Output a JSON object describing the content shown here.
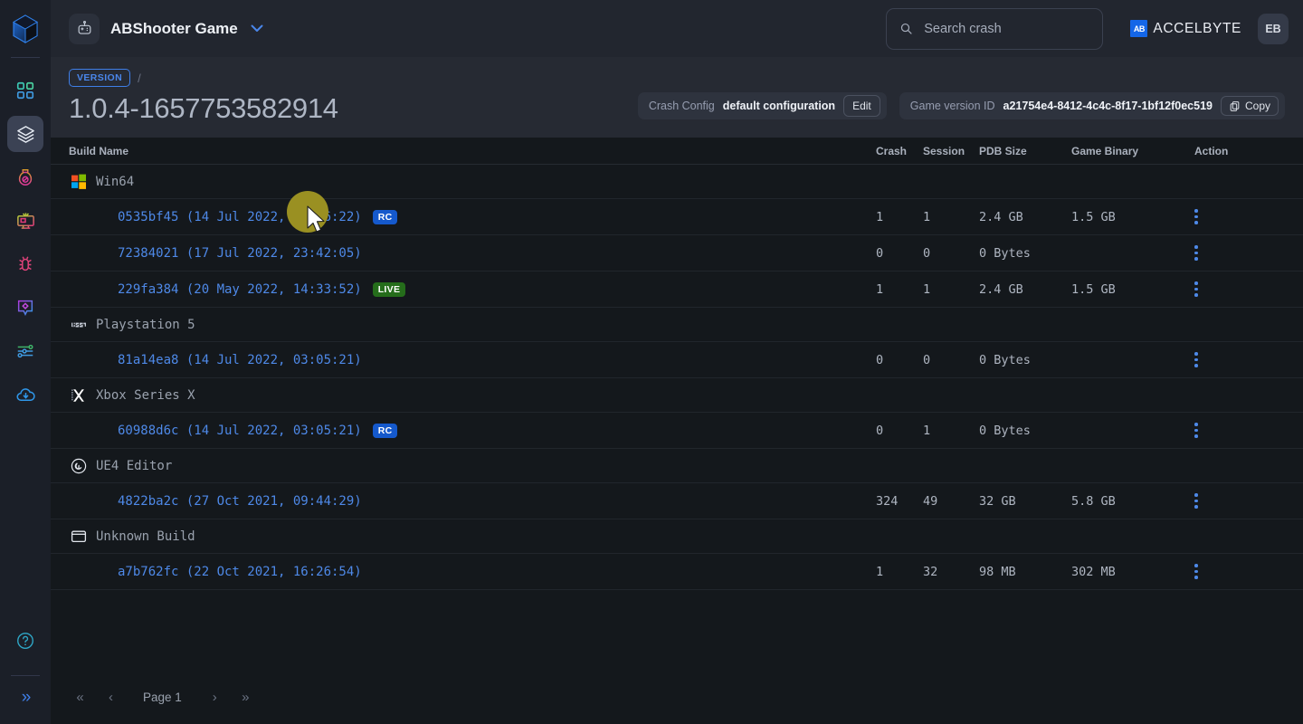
{
  "sidebar": {
    "logo_icon": "cube-logo-icon",
    "items": [
      {
        "name": "dashboard",
        "icon": "grid-dashboard-icon",
        "active": false
      },
      {
        "name": "builds",
        "icon": "layers-stack-icon",
        "active": true
      },
      {
        "name": "potions",
        "icon": "flask-potion-icon",
        "active": false
      },
      {
        "name": "monitoring",
        "icon": "monitor-screen-icon",
        "active": false
      },
      {
        "name": "bugs",
        "icon": "bug-icon",
        "active": false
      },
      {
        "name": "markers",
        "icon": "diamond-pin-icon",
        "active": false
      },
      {
        "name": "settings-sliders",
        "icon": "sliders-icon",
        "active": false
      },
      {
        "name": "uploads",
        "icon": "cloud-download-icon",
        "active": false
      }
    ],
    "help_icon": "question-circle-icon",
    "expand_icon": "chevron-double-right-icon",
    "expand_label": "»"
  },
  "topbar": {
    "game_icon": "robot-game-icon",
    "game_title": "ABShooter Game",
    "game_dropdown_icon": "chevron-down-icon",
    "search": {
      "icon": "search-icon",
      "placeholder": "Search crash",
      "value": ""
    },
    "brand": {
      "mark": "AB",
      "text": "ACCELBYTE"
    },
    "avatar_initials": "EB"
  },
  "breadcrumb": {
    "badge": "VERSION",
    "separator": "/"
  },
  "version": {
    "title": "1.0.4-1657753582914",
    "crash_config_label": "Crash Config",
    "crash_config_value": "default configuration",
    "edit_label": "Edit",
    "game_version_label": "Game version ID",
    "game_version_value": "a21754e4-8412-4c4c-8f17-1bf12f0ec519",
    "copy_label": "Copy",
    "copy_icon": "copy-icon"
  },
  "table": {
    "columns": [
      "Build Name",
      "Crash",
      "Session",
      "PDB Size",
      "Game Binary",
      "Action"
    ],
    "groups": [
      {
        "platform": "Win64",
        "icon": "windows-icon",
        "rows": [
          {
            "build": "0535bf45 (14 Jul 2022, 06:06:22)",
            "badge": "RC",
            "badge_type": "rc",
            "crash": "1",
            "session": "1",
            "pdb": "2.4 GB",
            "binary": "1.5 GB",
            "action_icon": "kebab-menu-icon"
          },
          {
            "build": "72384021 (17 Jul 2022, 23:42:05)",
            "badge": "",
            "badge_type": "",
            "crash": "0",
            "session": "0",
            "pdb": "0 Bytes",
            "binary": "",
            "action_icon": "kebab-menu-icon"
          },
          {
            "build": "229fa384 (20 May 2022, 14:33:52)",
            "badge": "LIVE",
            "badge_type": "live",
            "crash": "1",
            "session": "1",
            "pdb": "2.4 GB",
            "binary": "1.5 GB",
            "action_icon": "kebab-menu-icon"
          }
        ]
      },
      {
        "platform": "Playstation 5",
        "icon": "playstation5-icon",
        "rows": [
          {
            "build": "81a14ea8 (14 Jul 2022, 03:05:21)",
            "badge": "",
            "badge_type": "",
            "crash": "0",
            "session": "0",
            "pdb": "0 Bytes",
            "binary": "",
            "action_icon": "kebab-menu-icon"
          }
        ]
      },
      {
        "platform": "Xbox Series X",
        "icon": "xbox-icon",
        "rows": [
          {
            "build": "60988d6c (14 Jul 2022, 03:05:21)",
            "badge": "RC",
            "badge_type": "rc",
            "crash": "0",
            "session": "1",
            "pdb": "0 Bytes",
            "binary": "",
            "action_icon": "kebab-menu-icon"
          }
        ]
      },
      {
        "platform": "UE4 Editor",
        "icon": "unreal-engine-icon",
        "rows": [
          {
            "build": "4822ba2c (27 Oct 2021, 09:44:29)",
            "badge": "",
            "badge_type": "",
            "crash": "324",
            "session": "49",
            "pdb": "32 GB",
            "binary": "5.8 GB",
            "action_icon": "kebab-menu-icon"
          }
        ]
      },
      {
        "platform": "Unknown Build",
        "icon": "generic-window-icon",
        "rows": [
          {
            "build": "a7b762fc (22 Oct 2021, 16:26:54)",
            "badge": "",
            "badge_type": "",
            "crash": "1",
            "session": "32",
            "pdb": "98 MB",
            "binary": "302 MB",
            "action_icon": "kebab-menu-icon"
          }
        ]
      }
    ]
  },
  "pagination": {
    "first": "«",
    "prev": "‹",
    "label": "Page 1",
    "next": "›",
    "last": "»"
  },
  "colors": {
    "accent_blue": "#4e89e8",
    "badge_rc": "#1559cc",
    "badge_live": "#256d1b",
    "brand_blue": "#1466e8",
    "cursor_highlight": "#9a9022",
    "sidebar_bg": "#1b1f28",
    "topbar_bg": "#22262f",
    "version_bg": "#262a33",
    "table_bg": "#14181c"
  }
}
